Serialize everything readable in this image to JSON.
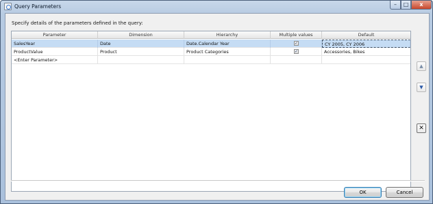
{
  "window": {
    "title": "Query Parameters",
    "controls": {
      "minimize": "–",
      "maximize": "□",
      "close": "x"
    }
  },
  "instruction": "Specify details of the parameters defined in the query:",
  "grid": {
    "columns": [
      "Parameter",
      "Dimension",
      "Hierarchy",
      "Multiple values",
      "Default"
    ],
    "rows": [
      {
        "parameter": "SalesYear",
        "dimension": "Date",
        "hierarchy": "Date.Calendar Year",
        "multiple_values": true,
        "default": "CY 2005, CY 2006",
        "selected": true
      },
      {
        "parameter": "ProductValue",
        "dimension": "Product",
        "hierarchy": "Product Categories",
        "multiple_values": true,
        "default": "Accessories, Bikes",
        "selected": false
      },
      {
        "parameter": "<Enter Parameter>",
        "dimension": "",
        "hierarchy": "",
        "multiple_values": null,
        "default": "",
        "selected": false
      }
    ]
  },
  "side_buttons": {
    "move_up": "▲",
    "move_down": "▼",
    "delete": "✕"
  },
  "buttons": {
    "ok": "OK",
    "cancel": "Cancel"
  },
  "colors": {
    "selected_row": "#c5dcf4",
    "title_bar": "#b7cbe2",
    "close_button": "#c8472c"
  }
}
